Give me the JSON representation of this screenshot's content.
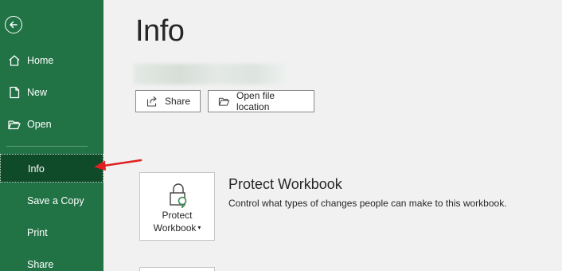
{
  "sidebar": {
    "items": [
      {
        "label": "Home",
        "icon": "home-icon"
      },
      {
        "label": "New",
        "icon": "new-file-icon"
      },
      {
        "label": "Open",
        "icon": "folder-open-icon"
      },
      {
        "label": "Info"
      },
      {
        "label": "Save a Copy"
      },
      {
        "label": "Print"
      },
      {
        "label": "Share"
      }
    ],
    "active_item": "Info",
    "colors": {
      "background": "#217346",
      "active": "#0f4a29"
    }
  },
  "main": {
    "title": "Info",
    "buttons": {
      "share_label": "Share",
      "open_location_label": "Open file location"
    },
    "protect": {
      "tile_label_line1": "Protect",
      "tile_label_line2": "Workbook",
      "title": "Protect Workbook",
      "description": "Control what types of changes people can make to this workbook."
    }
  },
  "annotation": {
    "arrow_color": "#e02020"
  }
}
